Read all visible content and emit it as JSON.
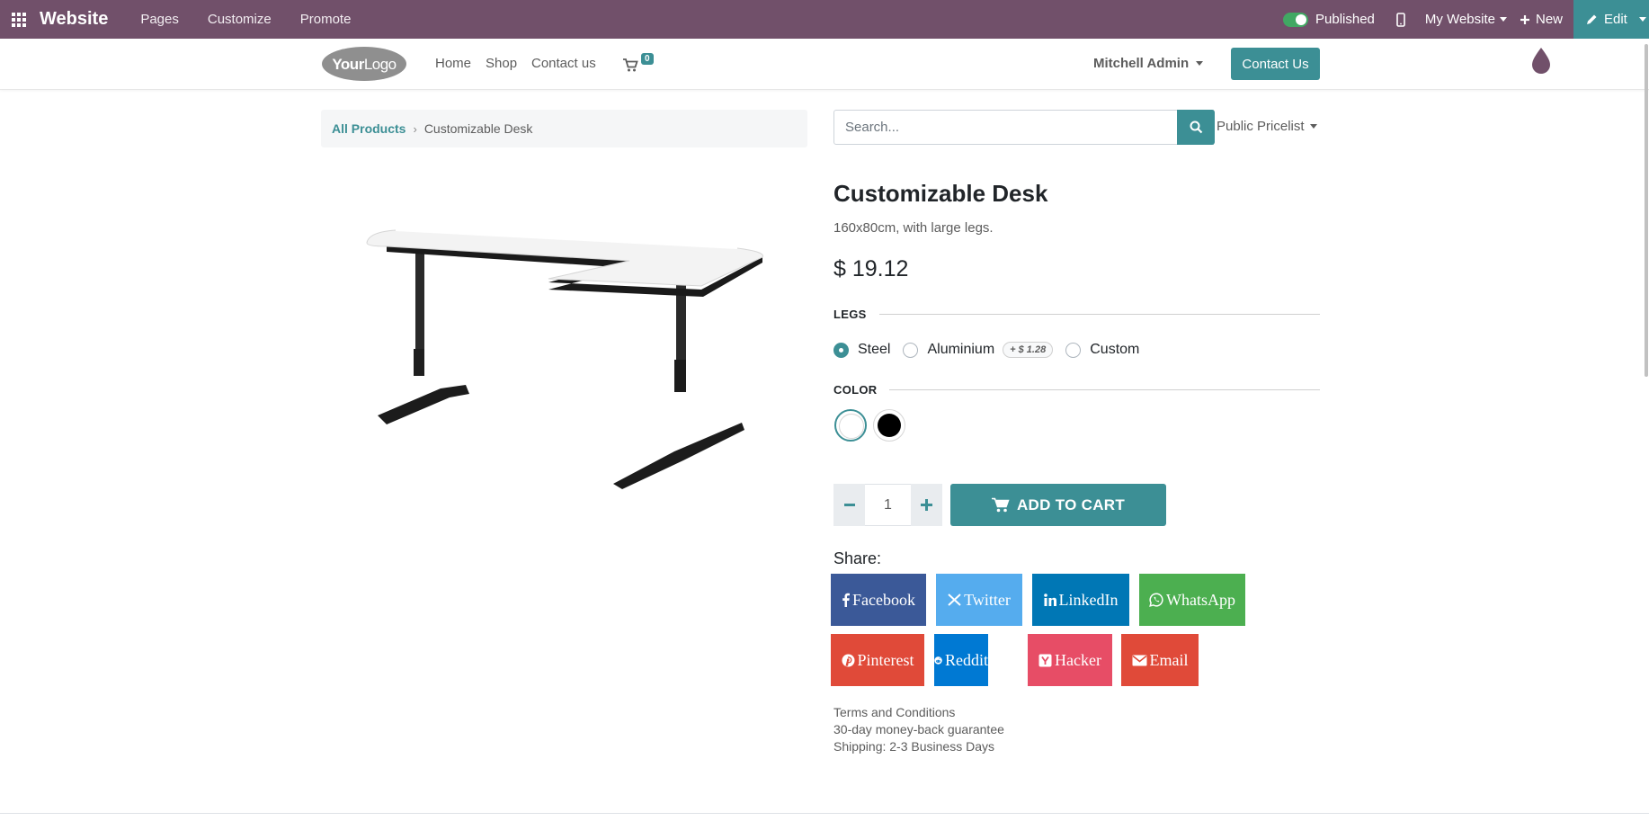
{
  "admin_bar": {
    "brand": "Website",
    "menu": [
      "Pages",
      "Customize",
      "Promote"
    ],
    "published_label": "Published",
    "website_selector": "My Website",
    "new_label": "New",
    "edit_label": "Edit"
  },
  "header": {
    "logo_text": "YourLogo",
    "nav": [
      "Home",
      "Shop",
      "Contact us"
    ],
    "cart_count": "0",
    "user": "Mitchell Admin",
    "contact_button": "Contact Us"
  },
  "breadcrumb": {
    "parent": "All Products",
    "separator": "›",
    "current": "Customizable Desk"
  },
  "search": {
    "placeholder": "Search...",
    "pricelist": "Public Pricelist"
  },
  "product": {
    "name": "Customizable Desk",
    "description": "160x80cm, with large legs.",
    "price": "$ 19.12",
    "attributes": {
      "legs": {
        "label": "LEGS",
        "options": [
          {
            "label": "Steel",
            "checked": true
          },
          {
            "label": "Aluminium",
            "extra": "+ $ 1.28",
            "checked": false
          },
          {
            "label": "Custom",
            "checked": false
          }
        ]
      },
      "color": {
        "label": "COLOR",
        "swatches": [
          {
            "name": "white",
            "hex": "#ffffff",
            "selected": true
          },
          {
            "name": "black",
            "hex": "#000000",
            "selected": false
          }
        ]
      }
    },
    "quantity": "1",
    "add_to_cart": "ADD TO CART"
  },
  "share": {
    "label": "Share:",
    "buttons": [
      {
        "label": "Facebook",
        "color": "#3b5998"
      },
      {
        "label": "Twitter",
        "color": "#55acee"
      },
      {
        "label": "LinkedIn",
        "color": "#0077b5"
      },
      {
        "label": "WhatsApp",
        "color": "#4caf50"
      },
      {
        "label": "Pinterest",
        "color": "#e04a39"
      },
      {
        "label": "Reddit",
        "color": "#0079d3"
      },
      {
        "label": "Hacker",
        "color": "#e74d66"
      },
      {
        "label": "Email",
        "color": "#e04a39"
      }
    ]
  },
  "info": [
    "Terms and Conditions",
    "30-day money-back guarantee",
    "Shipping: 2-3 Business Days"
  ],
  "colors": {
    "admin_bar": "#71506a",
    "accent": "#3c8f95"
  }
}
